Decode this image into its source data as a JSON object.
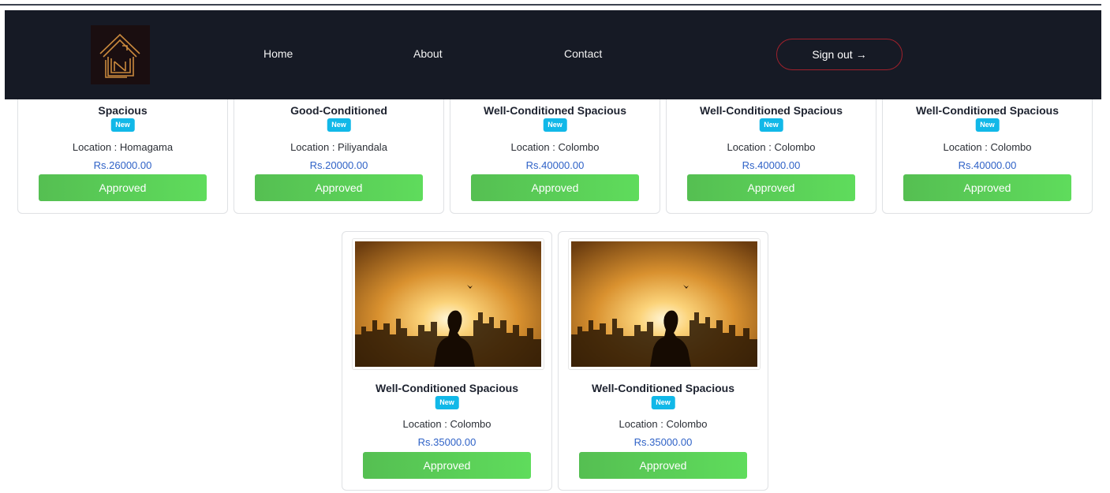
{
  "nav": {
    "links": [
      "Home",
      "About",
      "Contact"
    ],
    "signout_label": "Sign out",
    "signout_arrow": "→"
  },
  "top_cards": [
    {
      "title": "Spacious",
      "badge": "New",
      "location": "Location : Homagama",
      "price": "Rs.26000.00",
      "status": "Approved"
    },
    {
      "title": "Good-Conditioned",
      "badge": "New",
      "location": "Location : Piliyandala",
      "price": "Rs.20000.00",
      "status": "Approved"
    },
    {
      "title": "Well-Conditioned Spacious",
      "badge": "New",
      "location": "Location : Colombo",
      "price": "Rs.40000.00",
      "status": "Approved"
    },
    {
      "title": "Well-Conditioned Spacious",
      "badge": "New",
      "location": "Location : Colombo",
      "price": "Rs.40000.00",
      "status": "Approved"
    },
    {
      "title": "Well-Conditioned Spacious",
      "badge": "New",
      "location": "Location : Colombo",
      "price": "Rs.40000.00",
      "status": "Approved"
    }
  ],
  "bottom_cards": [
    {
      "title": "Well-Conditioned Spacious",
      "badge": "New",
      "location": "Location : Colombo",
      "price": "Rs.35000.00",
      "status": "Approved"
    },
    {
      "title": "Well-Conditioned Spacious",
      "badge": "New",
      "location": "Location : Colombo",
      "price": "Rs.35000.00",
      "status": "Approved"
    }
  ],
  "colors": {
    "navbar": "#161a25",
    "badge": "#11b8e8",
    "price": "#2f62c7",
    "approve": "#55bf52",
    "signout_border": "#a0212c"
  }
}
